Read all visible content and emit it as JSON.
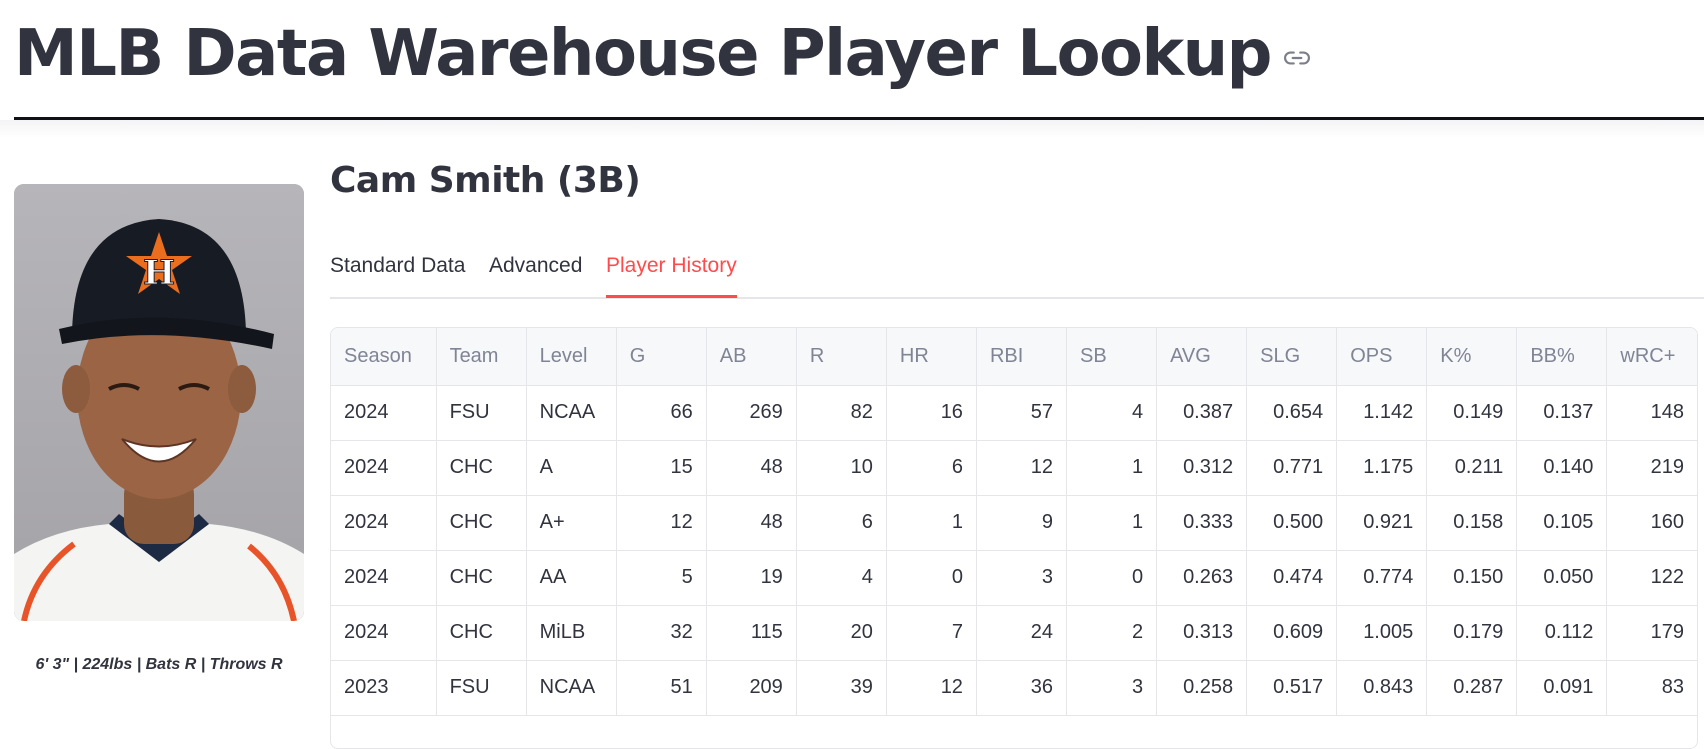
{
  "page": {
    "title": "MLB Data Warehouse Player Lookup"
  },
  "player": {
    "name": "Cam Smith (3B)",
    "bio": "6' 3\" | 224lbs | Bats R | Throws R"
  },
  "tabs": [
    {
      "label": "Standard Data",
      "active": false
    },
    {
      "label": "Advanced",
      "active": false
    },
    {
      "label": "Player History",
      "active": true
    }
  ],
  "colors": {
    "accent": "#ff4b4b",
    "text": "#31333f",
    "header_text": "#808495"
  },
  "history_table": {
    "columns": [
      "Season",
      "Team",
      "Level",
      "G",
      "AB",
      "R",
      "HR",
      "RBI",
      "SB",
      "AVG",
      "SLG",
      "OPS",
      "K%",
      "BB%",
      "wRC+"
    ],
    "rows": [
      [
        "2024",
        "FSU",
        "NCAA",
        "66",
        "269",
        "82",
        "16",
        "57",
        "4",
        "0.387",
        "0.654",
        "1.142",
        "0.149",
        "0.137",
        "148"
      ],
      [
        "2024",
        "CHC",
        "A",
        "15",
        "48",
        "10",
        "6",
        "12",
        "1",
        "0.312",
        "0.771",
        "1.175",
        "0.211",
        "0.140",
        "219"
      ],
      [
        "2024",
        "CHC",
        "A+",
        "12",
        "48",
        "6",
        "1",
        "9",
        "1",
        "0.333",
        "0.500",
        "0.921",
        "0.158",
        "0.105",
        "160"
      ],
      [
        "2024",
        "CHC",
        "AA",
        "5",
        "19",
        "4",
        "0",
        "3",
        "0",
        "0.263",
        "0.474",
        "0.774",
        "0.150",
        "0.050",
        "122"
      ],
      [
        "2024",
        "CHC",
        "MiLB",
        "32",
        "115",
        "20",
        "7",
        "24",
        "2",
        "0.313",
        "0.609",
        "1.005",
        "0.179",
        "0.112",
        "179"
      ],
      [
        "2023",
        "FSU",
        "NCAA",
        "51",
        "209",
        "39",
        "12",
        "36",
        "3",
        "0.258",
        "0.517",
        "0.843",
        "0.287",
        "0.091",
        "83"
      ]
    ]
  }
}
